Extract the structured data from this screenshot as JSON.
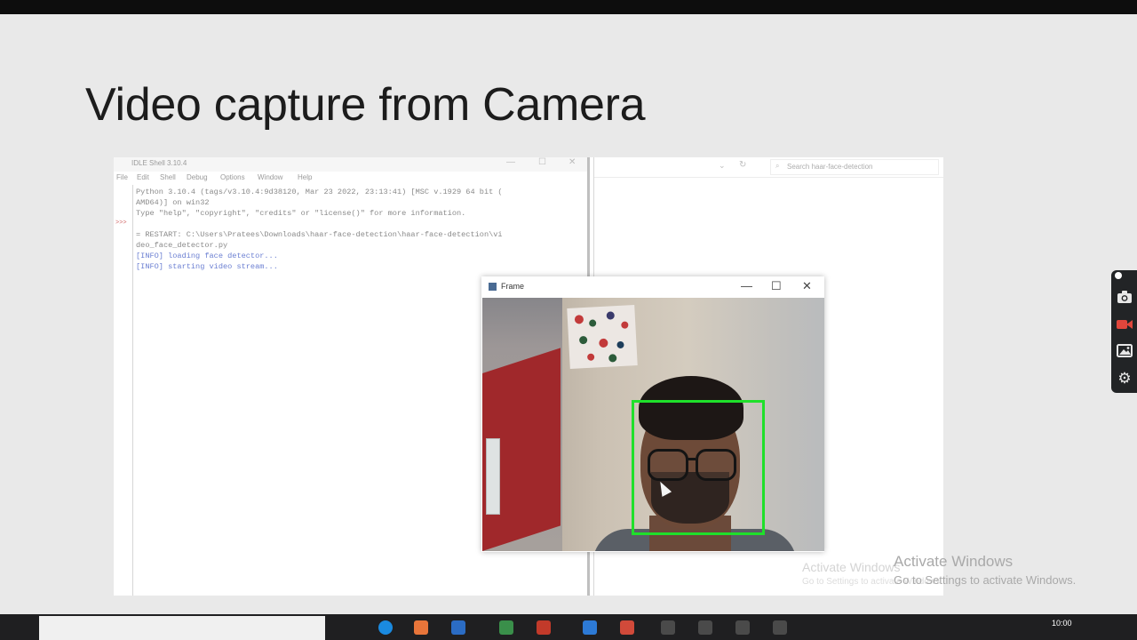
{
  "slide": {
    "title": "Video capture from Camera"
  },
  "idle": {
    "title": "IDLE Shell 3.10.4",
    "menu": [
      "File",
      "Edit",
      "Shell",
      "Debug",
      "Options",
      "Window",
      "Help"
    ],
    "gutter": ">>>",
    "lines": [
      "Python 3.10.4 (tags/v3.10.4:9d38120, Mar 23 2022, 23:13:41) [MSC v.1929 64 bit (",
      "AMD64)] on win32",
      "Type \"help\", \"copyright\", \"credits\" or \"license()\" for more information.",
      "",
      "= RESTART: C:\\Users\\Pratees\\Downloads\\haar-face-detection\\haar-face-detection\\vi",
      "deo_face_detector.py"
    ],
    "info_lines": [
      "[INFO] loading face detector...",
      "[INFO] starting video stream..."
    ]
  },
  "explorer": {
    "search_placeholder": "Search haar-face-detection"
  },
  "frame": {
    "title": "Frame",
    "minimize": "—",
    "maximize": "☐",
    "close": "✕"
  },
  "watermark": {
    "title": "Activate Windows",
    "subtitle": "Go to Settings to activate Windows."
  },
  "taskbar": {
    "clock": "10:00"
  },
  "colors": {
    "detection_box": "#1fe02a",
    "recorder_accent": "#e0463c",
    "info_text": "#6b7fd2"
  },
  "icons": [
    "camera-icon",
    "video-record-icon",
    "image-icon",
    "gear-icon"
  ]
}
